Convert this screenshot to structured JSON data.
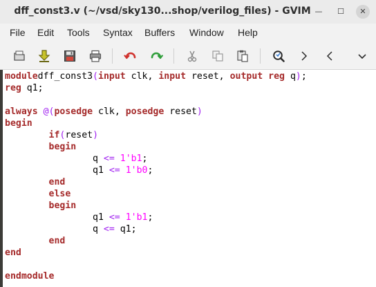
{
  "window": {
    "title": "dff_const3.v (~/vsd/sky130...shop/verilog_files) - GVIM",
    "controls": {
      "minimize": "—",
      "maximize": "☐",
      "close": "✕"
    }
  },
  "menu": [
    "File",
    "Edit",
    "Tools",
    "Syntax",
    "Buffers",
    "Window",
    "Help"
  ],
  "toolbar": {
    "icons": [
      "open-icon",
      "download-icon",
      "save-icon",
      "print-icon",
      "undo-icon",
      "redo-icon",
      "cut-icon",
      "copy-icon",
      "paste-icon",
      "find-replace-icon",
      "find-next-icon",
      "find-prev-icon",
      "overflow-chevron-icon"
    ]
  },
  "colors": {
    "keyword": "#a52a2a",
    "preproc": "#a020f0",
    "number": "#ff00ff",
    "text": "#000000"
  },
  "code": [
    [
      [
        "kw",
        "module"
      ],
      [
        "",
        "dff_const3"
      ],
      [
        "pp",
        "("
      ],
      [
        "kw",
        "input"
      ],
      [
        "",
        " clk, "
      ],
      [
        "kw",
        "input"
      ],
      [
        "",
        " reset, "
      ],
      [
        "kw",
        "output"
      ],
      [
        "",
        " "
      ],
      [
        "kw",
        "reg"
      ],
      [
        "",
        " q"
      ],
      [
        "pp",
        ")"
      ],
      [
        "",
        ";"
      ]
    ],
    [
      [
        "kw",
        "reg"
      ],
      [
        "",
        " q1;"
      ]
    ],
    [],
    [
      [
        "kw",
        "always"
      ],
      [
        "",
        " "
      ],
      [
        "pp",
        "@("
      ],
      [
        "kw",
        "posedge"
      ],
      [
        "",
        " clk, "
      ],
      [
        "kw",
        "posedge"
      ],
      [
        "",
        " reset"
      ],
      [
        "pp",
        ")"
      ]
    ],
    [
      [
        "kw",
        "begin"
      ]
    ],
    [
      [
        "",
        "        "
      ],
      [
        "kw",
        "if"
      ],
      [
        "pp",
        "("
      ],
      [
        "",
        "reset"
      ],
      [
        "pp",
        ")"
      ]
    ],
    [
      [
        "",
        "        "
      ],
      [
        "kw",
        "begin"
      ]
    ],
    [
      [
        "",
        "                q "
      ],
      [
        "pp",
        "<="
      ],
      [
        "",
        " "
      ],
      [
        "num",
        "1'b1"
      ],
      [
        "",
        ";"
      ]
    ],
    [
      [
        "",
        "                q1 "
      ],
      [
        "pp",
        "<="
      ],
      [
        "",
        " "
      ],
      [
        "num",
        "1'b0"
      ],
      [
        "",
        ";"
      ]
    ],
    [
      [
        "",
        "        "
      ],
      [
        "kw",
        "end"
      ]
    ],
    [
      [
        "",
        "        "
      ],
      [
        "kw",
        "else"
      ]
    ],
    [
      [
        "",
        "        "
      ],
      [
        "kw",
        "begin"
      ]
    ],
    [
      [
        "",
        "                q1 "
      ],
      [
        "pp",
        "<="
      ],
      [
        "",
        " "
      ],
      [
        "num",
        "1'b1"
      ],
      [
        "",
        ";"
      ]
    ],
    [
      [
        "",
        "                q "
      ],
      [
        "pp",
        "<="
      ],
      [
        "",
        " q1;"
      ]
    ],
    [
      [
        "",
        "        "
      ],
      [
        "kw",
        "end"
      ]
    ],
    [
      [
        "kw",
        "end"
      ]
    ],
    [],
    [
      [
        "kw",
        "endmodule"
      ]
    ]
  ]
}
